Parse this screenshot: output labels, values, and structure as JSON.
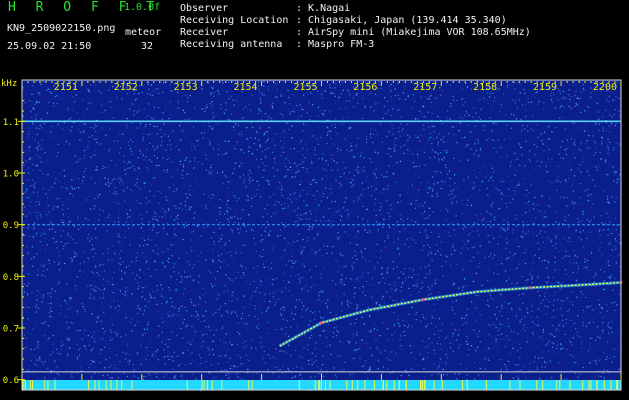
{
  "header": {
    "app_name": "H R O F F T",
    "version": "1.0.0f",
    "filename": "KN9_2509022150.png",
    "mode_label": "meteor",
    "datetime": "25.09.02 21:50",
    "count": "32",
    "metadata": [
      {
        "label": "Observer",
        "value": ": K.Nagai"
      },
      {
        "label": "Receiving Location",
        "value": ": Chigasaki, Japan (139.414 35.340)"
      },
      {
        "label": "Receiver",
        "value": ": AirSpy mini (Miakejima VOR 108.65MHz)"
      },
      {
        "label": "Receiving antenna",
        "value": ": Maspro FM-3"
      }
    ]
  },
  "chart_data": {
    "type": "heatmap",
    "ylabel": "kHz",
    "x_ticks": [
      "2151",
      "2152",
      "2153",
      "2154",
      "2155",
      "2156",
      "2157",
      "2158",
      "2159",
      "2200"
    ],
    "y_ticks": [
      "0.6",
      "0.7",
      "0.8",
      "0.9",
      "1.0",
      "1.1"
    ],
    "ylim": [
      0.58,
      1.18
    ],
    "x_tick_values_min": [
      1,
      2,
      3,
      4,
      5,
      6,
      7,
      8,
      9,
      10
    ],
    "xlim_min": [
      0,
      10
    ],
    "horizontal_lines_khz": [
      1.1,
      0.9
    ],
    "meteor_trail": {
      "start_min": 4.3,
      "end_min": 10.0,
      "points": [
        {
          "t": 4.3,
          "f": 0.665
        },
        {
          "t": 5.0,
          "f": 0.71
        },
        {
          "t": 5.8,
          "f": 0.735
        },
        {
          "t": 6.7,
          "f": 0.755
        },
        {
          "t": 7.6,
          "f": 0.77
        },
        {
          "t": 8.5,
          "f": 0.778
        },
        {
          "t": 9.3,
          "f": 0.783
        },
        {
          "t": 10.0,
          "f": 0.788
        }
      ]
    },
    "colors": {
      "background": "#0b1f8c",
      "noise_light": "#4f7bff",
      "noise_cyan": "#2ac6ff",
      "axis_text": "#f0f000",
      "frame": "#d8d8d8",
      "bottom_band": "#22d8ff"
    }
  }
}
